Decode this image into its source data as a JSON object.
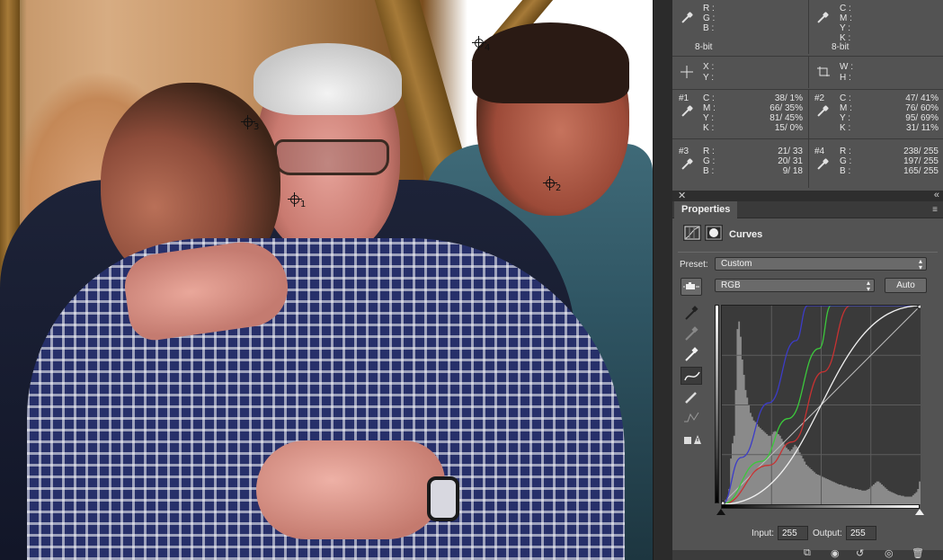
{
  "info": {
    "rgb_top": {
      "labels": [
        "R :",
        "G :",
        "B :"
      ],
      "depth": "8-bit"
    },
    "cmyk_top": {
      "labels": [
        "C :",
        "M :",
        "Y :",
        "K :"
      ],
      "depth": "8-bit"
    },
    "xy": {
      "labels": [
        "X :",
        "Y :"
      ]
    },
    "wh": {
      "labels": [
        "W :",
        "H :"
      ]
    },
    "samplers": [
      {
        "id": "#1",
        "labels": [
          "C :",
          "M :",
          "Y :",
          "K :"
        ],
        "values": [
          "38/  1%",
          "66/ 35%",
          "81/ 45%",
          "15/  0%"
        ]
      },
      {
        "id": "#2",
        "labels": [
          "C :",
          "M :",
          "Y :",
          "K :"
        ],
        "values": [
          "47/ 41%",
          "76/ 60%",
          "95/ 69%",
          "31/ 11%"
        ]
      },
      {
        "id": "#3",
        "labels": [
          "R :",
          "G :",
          "B :"
        ],
        "values": [
          "21/  33",
          "20/  31",
          "9/  18"
        ]
      },
      {
        "id": "#4",
        "labels": [
          "R :",
          "G :",
          "B :"
        ],
        "values": [
          "238/ 255",
          "197/ 255",
          "165/ 255"
        ]
      }
    ]
  },
  "canvas": {
    "samplers": [
      "1",
      "2",
      "3",
      "4"
    ]
  },
  "properties": {
    "tab_label": "Properties",
    "title": "Curves",
    "preset_label": "Preset:",
    "preset_value": "Custom",
    "channel_value": "RGB",
    "auto_label": "Auto",
    "input_label": "Input:",
    "input_value": "255",
    "output_label": "Output:",
    "output_value": "255"
  },
  "curves": {
    "red": [
      [
        0,
        0
      ],
      [
        60,
        50
      ],
      [
        90,
        80
      ],
      [
        130,
        170
      ],
      [
        165,
        255
      ],
      [
        255,
        255
      ]
    ],
    "green": [
      [
        0,
        0
      ],
      [
        50,
        55
      ],
      [
        85,
        110
      ],
      [
        125,
        200
      ],
      [
        140,
        255
      ],
      [
        255,
        255
      ]
    ],
    "blue": [
      [
        0,
        0
      ],
      [
        25,
        60
      ],
      [
        60,
        130
      ],
      [
        95,
        210
      ],
      [
        110,
        255
      ],
      [
        255,
        255
      ]
    ],
    "rgb": [
      [
        0,
        0
      ],
      [
        255,
        255
      ]
    ]
  },
  "histogram": [
    2,
    3,
    5,
    9,
    20,
    60,
    80,
    90,
    150,
    230,
    240,
    220,
    190,
    170,
    150,
    140,
    130,
    120,
    115,
    110,
    108,
    105,
    102,
    100,
    98,
    96,
    94,
    92,
    90,
    90,
    92,
    95,
    96,
    95,
    92,
    90,
    86,
    82,
    78,
    74,
    72,
    70,
    72,
    75,
    78,
    76,
    72,
    68,
    64,
    60,
    56,
    52,
    50,
    48,
    46,
    44,
    42,
    40,
    39,
    38,
    37,
    36,
    35,
    34,
    33,
    32,
    31,
    30,
    29,
    28,
    27,
    26,
    26,
    25,
    24,
    24,
    23,
    22,
    22,
    21,
    21,
    20,
    20,
    19,
    19,
    18,
    18,
    18,
    19,
    20,
    22,
    24,
    26,
    28,
    30,
    30,
    28,
    26,
    24,
    22,
    20,
    18,
    17,
    16,
    15,
    14,
    13,
    12,
    12,
    11,
    11,
    10,
    10,
    10,
    10,
    10,
    12,
    14,
    16,
    20,
    30
  ],
  "colors": {
    "panel": "#535353",
    "red_curve": "#c83232",
    "green_curve": "#3cc83c",
    "blue_curve": "#3c3cc8"
  }
}
